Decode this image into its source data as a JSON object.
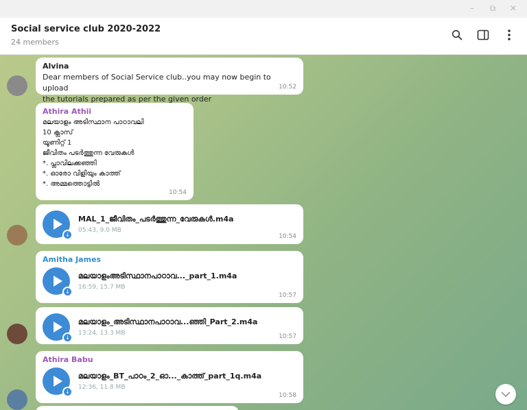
{
  "window": {
    "controls": [
      "minimize-icon",
      "restore-icon",
      "close-icon"
    ]
  },
  "header": {
    "title": "Social service club 2020-2022",
    "subtitle": "24 members",
    "icons": [
      "search-icon",
      "sidebar-toggle-icon",
      "more-vert-icon"
    ]
  },
  "theme": {
    "accent": "#3d8bd6",
    "sender_purple": "#9b59b6",
    "sender_blue": "#2f8fd0"
  },
  "messages": [
    {
      "sender": "Alvina",
      "text": "Dear members of Social Service club..you may now begin to upload\nthe tutorials prepared as per the given order",
      "time": "10:52"
    },
    {
      "sender": "Athira Athii",
      "text": "മലയാളം അടിസ്ഥാന പാഠാവലി\n10 ക്ലാസ്\n           യൂണിറ്റ് 1\nജീവിതം പടർത്തുന്ന വേരുകൾ\n*. പ്ലാവിലക്കഞ്ഞി\n*. ഓരോ വിളിയും കാത്ത്\n*. അമ്മത്തൊട്ടിൽ",
      "time": "10:54"
    },
    {
      "file_name": "MAL_1_ജീവിതം_പടർത്തുന്ന_വേരുകൾ.m4a",
      "file_meta": "05:43, 9.0 MB",
      "time": "10:54"
    },
    {
      "sender": "Amitha James",
      "file_name": "മലയാളംഅടിസ്ഥാനപാഠാവ..._part_1.m4a",
      "file_meta": "16:59, 15.7 MB",
      "time": "10:57"
    },
    {
      "file_name": "മലയാളം_അടിസ്ഥാനപാഠാവ...ഞ്ഞി_Part_2.m4a",
      "file_meta": "13:24, 13.3 MB",
      "time": "10:57"
    },
    {
      "sender": "Athira Babu",
      "file_name": "മലയാളം_BT_പാഠം_2_ഓ..._കാത്ത്_part_1q.m4a",
      "file_meta": "12:36, 11.8 MB",
      "time": "10:58"
    }
  ]
}
